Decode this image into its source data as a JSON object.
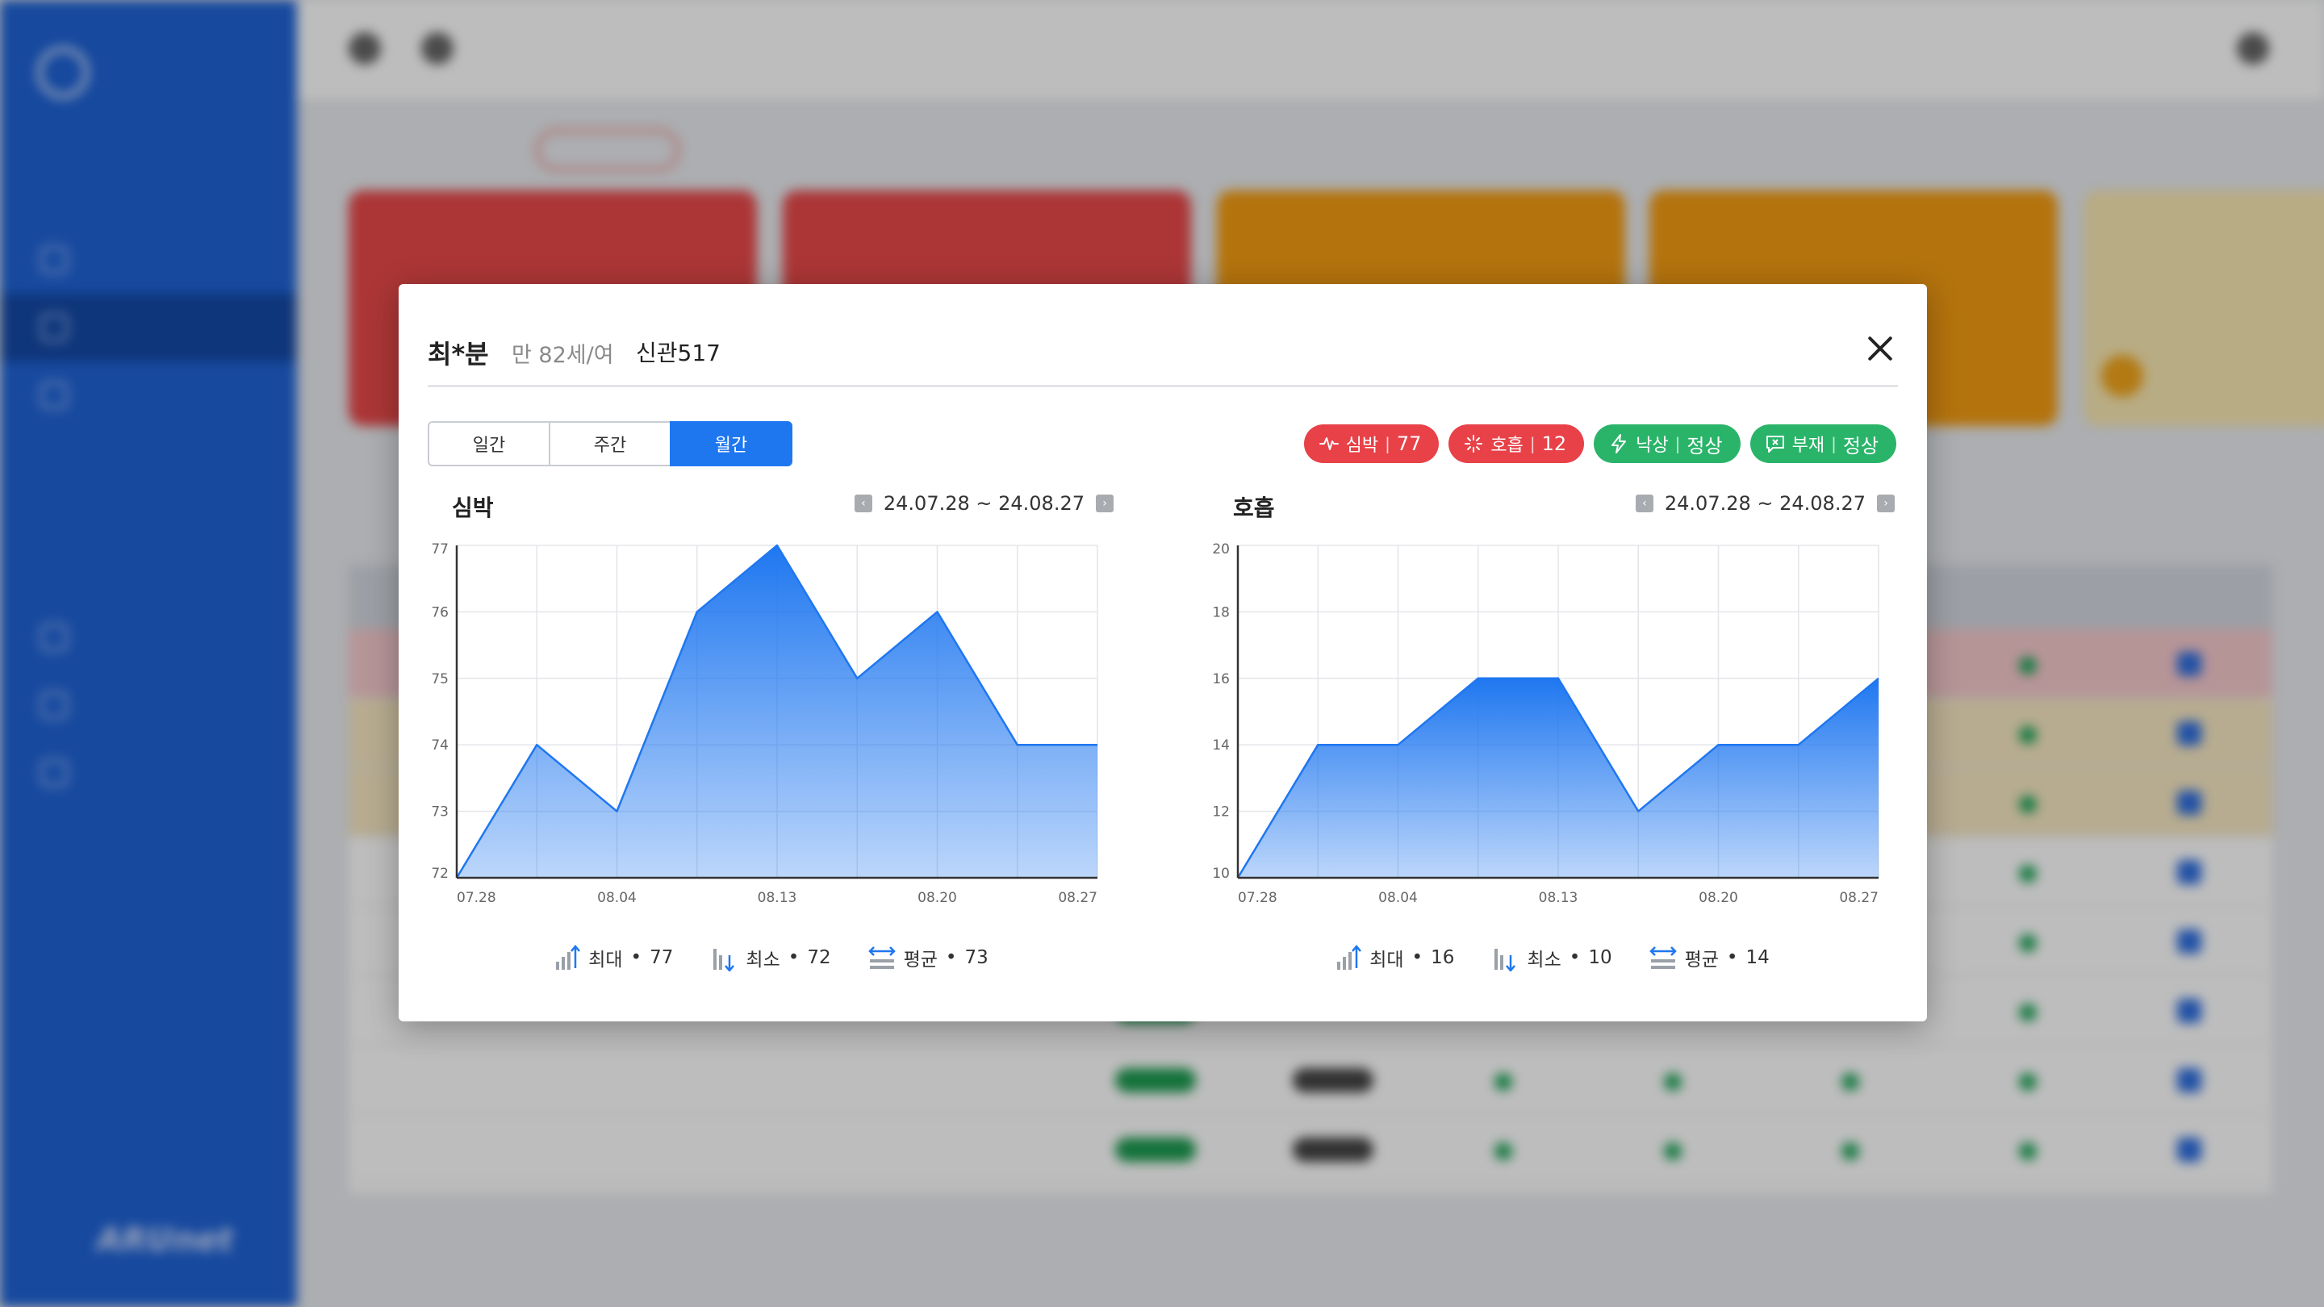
{
  "background": {
    "logo_text": "",
    "brand": "ARUnet"
  },
  "modal": {
    "patient": {
      "name": "최*분",
      "age_gender": "만 82세/여",
      "room": "신관517"
    },
    "tabs": [
      {
        "label": "일간",
        "active": false
      },
      {
        "label": "주간",
        "active": false
      },
      {
        "label": "월간",
        "active": true
      }
    ],
    "badges": [
      {
        "label": "심박",
        "value": "77",
        "color": "#e84148",
        "icon": "heartbeat-icon"
      },
      {
        "label": "호흡",
        "value": "12",
        "color": "#e84148",
        "icon": "breath-icon"
      },
      {
        "label": "낙상",
        "value": "정상",
        "color": "#2ab469",
        "icon": "fall-icon"
      },
      {
        "label": "부재",
        "value": "정상",
        "color": "#2ab469",
        "icon": "absence-icon"
      }
    ],
    "charts": [
      {
        "title": "심박",
        "range": "24.07.28 ~ 24.08.27",
        "stats": {
          "max_label": "최대",
          "max": "77",
          "min_label": "최소",
          "min": "72",
          "avg_label": "평균",
          "avg": "73"
        }
      },
      {
        "title": "호흡",
        "range": "24.07.28 ~ 24.08.27",
        "stats": {
          "max_label": "최대",
          "max": "16",
          "min_label": "최소",
          "min": "10",
          "avg_label": "평균",
          "avg": "14"
        }
      }
    ]
  },
  "chart_data": [
    {
      "type": "area",
      "title": "심박",
      "x_tick_labels": [
        "07.28",
        "08.04",
        "08.13",
        "08.20",
        "08.27"
      ],
      "y_tick_labels": [
        "77",
        "76",
        "75",
        "74",
        "73",
        "72"
      ],
      "ylim": [
        72,
        77
      ],
      "values": [
        72,
        74,
        73,
        76,
        77,
        75,
        76,
        74,
        74
      ],
      "grid": true,
      "color": "#1f77f0"
    },
    {
      "type": "area",
      "title": "호흡",
      "x_tick_labels": [
        "07.28",
        "08.04",
        "08.13",
        "08.20",
        "08.27"
      ],
      "y_tick_labels": [
        "20",
        "18",
        "16",
        "14",
        "12",
        "10"
      ],
      "ylim": [
        10,
        20
      ],
      "values": [
        10,
        14,
        14,
        16,
        16,
        12,
        14,
        14,
        16
      ],
      "grid": true,
      "color": "#1f77f0"
    }
  ]
}
